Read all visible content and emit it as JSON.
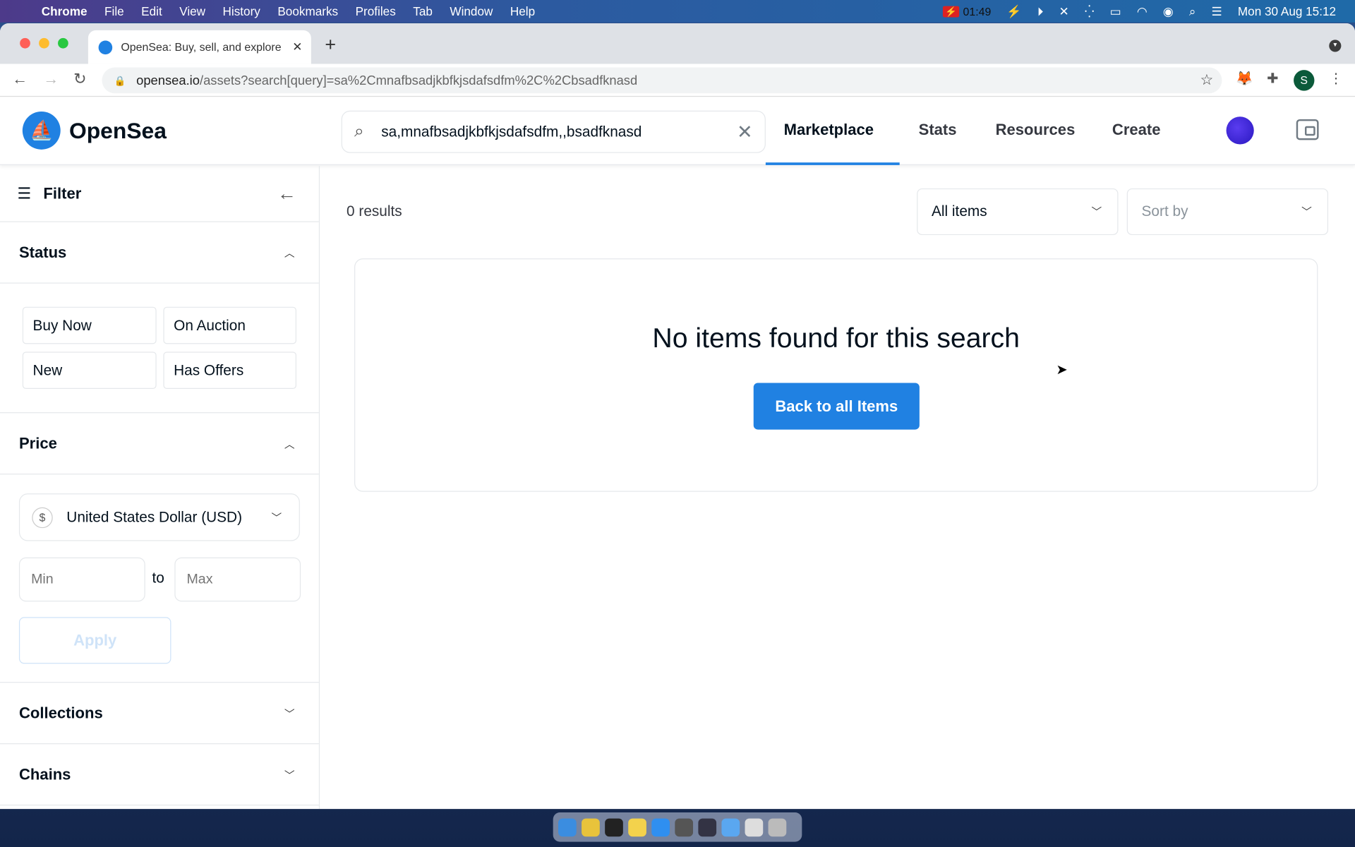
{
  "menubar": {
    "app": "Chrome",
    "items": [
      "File",
      "Edit",
      "View",
      "History",
      "Bookmarks",
      "Profiles",
      "Tab",
      "Window",
      "Help"
    ],
    "recorder_time": "01:49",
    "datetime": "Mon 30 Aug  15:12"
  },
  "browser": {
    "tab_title": "OpenSea: Buy, sell, and explore",
    "url_host": "opensea.io",
    "url_path": "/assets?search[query]=sa%2Cmnafbsadjkbfkjsdafsdfm%2C%2Cbsadfknasd",
    "profile_initial": "S"
  },
  "header": {
    "brand": "OpenSea",
    "search_value": "sa,mnafbsadjkbfkjsdafsdfm,,bsadfknasd",
    "nav": [
      "Marketplace",
      "Stats",
      "Resources",
      "Create"
    ],
    "active_nav": "Marketplace",
    "accent": "#2081e2"
  },
  "sidebar": {
    "title": "Filter",
    "status": {
      "title": "Status",
      "chips": [
        "Buy Now",
        "On Auction",
        "New",
        "Has Offers"
      ]
    },
    "price": {
      "title": "Price",
      "currency": "United States Dollar (USD)",
      "currency_symbol": "$",
      "min_placeholder": "Min",
      "max_placeholder": "Max",
      "to": "to",
      "apply": "Apply"
    },
    "collections": "Collections",
    "chains": "Chains"
  },
  "main": {
    "results": "0 results",
    "items_filter": "All items",
    "sort_placeholder": "Sort by",
    "empty_message": "No items found for this search",
    "back_button": "Back to all Items"
  }
}
